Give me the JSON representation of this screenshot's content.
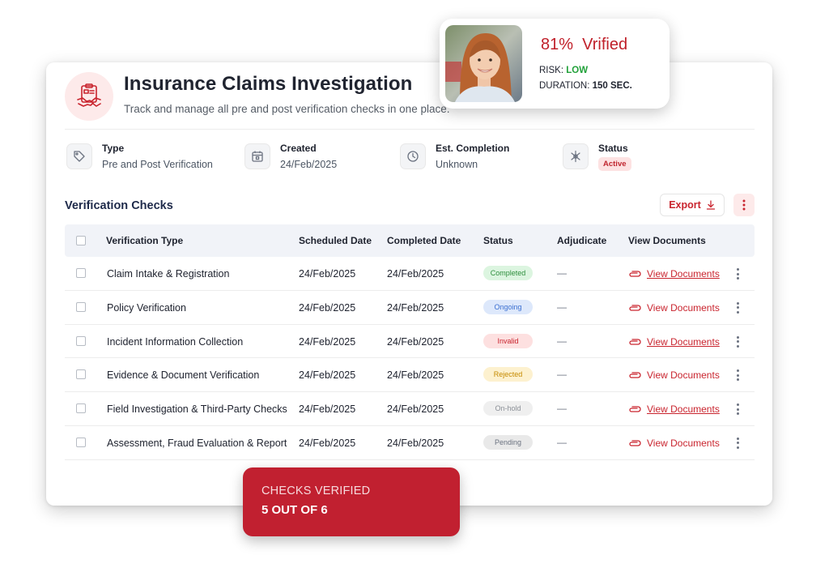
{
  "header": {
    "title": "Insurance Claims Investigation",
    "subtitle": "Track and manage all pre and post verification checks in one place.",
    "icon": "handshake-clipboard-icon"
  },
  "meta": [
    {
      "label": "Type",
      "value": "Pre and Post Verification",
      "icon": "tag-icon"
    },
    {
      "label": "Created",
      "value": "24/Feb/2025",
      "icon": "calendar-icon"
    },
    {
      "label": "Est. Completion",
      "value": "Unknown",
      "icon": "clock-icon"
    },
    {
      "label": "Status",
      "value": "Active",
      "icon": "status-icon"
    }
  ],
  "section": {
    "title": "Verification Checks",
    "export_label": "Export"
  },
  "table": {
    "columns": [
      "Verification Type",
      "Scheduled Date",
      "Completed Date",
      "Status",
      "Adjudicate",
      "View Documents"
    ],
    "rows": [
      {
        "type": "Claim Intake & Registration",
        "scheduled": "24/Feb/2025",
        "completed": "24/Feb/2025",
        "status": "Completed",
        "adjudicate": "—",
        "docs": "View Documents"
      },
      {
        "type": "Policy Verification",
        "scheduled": "24/Feb/2025",
        "completed": "24/Feb/2025",
        "status": "Ongoing",
        "adjudicate": "—",
        "docs": "View Documents"
      },
      {
        "type": "Incident Information Collection",
        "scheduled": "24/Feb/2025",
        "completed": "24/Feb/2025",
        "status": "Invalid",
        "adjudicate": "—",
        "docs": "View Documents"
      },
      {
        "type": "Evidence & Document Verification",
        "scheduled": "24/Feb/2025",
        "completed": "24/Feb/2025",
        "status": "Rejected",
        "adjudicate": "—",
        "docs": "View Documents"
      },
      {
        "type": "Field Investigation & Third-Party Checks",
        "scheduled": "24/Feb/2025",
        "completed": "24/Feb/2025",
        "status": "On-hold",
        "adjudicate": "—",
        "docs": "View Documents"
      },
      {
        "type": "Assessment, Fraud Evaluation & Report",
        "scheduled": "24/Feb/2025",
        "completed": "24/Feb/2025",
        "status": "Pending",
        "adjudicate": "—",
        "docs": "View Documents"
      }
    ]
  },
  "status_colors": {
    "Completed": {
      "bg": "#dcf5e0",
      "fg": "#2f8f3e"
    },
    "Ongoing": {
      "bg": "#dde8fb",
      "fg": "#3b6fd1"
    },
    "Invalid": {
      "bg": "#fde0e0",
      "fg": "#c9242e"
    },
    "Rejected": {
      "bg": "#fdf1cf",
      "fg": "#c58a00"
    },
    "On-hold": {
      "bg": "#efefef",
      "fg": "#8a8f96"
    },
    "Pending": {
      "bg": "#e9e9e9",
      "fg": "#6b7280"
    }
  },
  "profile": {
    "percent": "81%",
    "verified_label": "Vrified",
    "risk_label": "RISK:",
    "risk_value": "LOW",
    "duration_label": "DURATION:",
    "duration_value": "150 SEC."
  },
  "checks_card": {
    "label": "CHECKS VERIFIED",
    "value": "5  OUT OF 6"
  },
  "colors": {
    "accent": "#c9242e",
    "accent_bg": "#fdeaea",
    "risk_low": "#22a13a"
  }
}
